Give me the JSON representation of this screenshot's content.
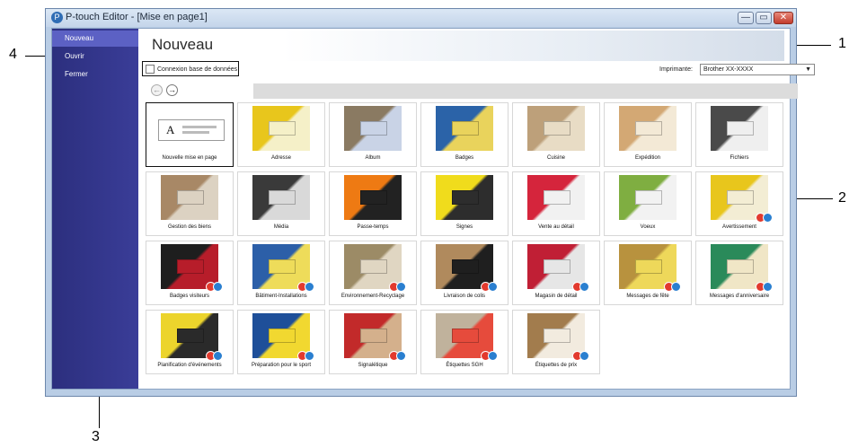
{
  "window": {
    "title": "P-touch Editor - [Mise en page1]",
    "controls": {
      "minimize": "—",
      "maximize": "▭",
      "close": "✕"
    }
  },
  "sidebar": {
    "items": [
      {
        "label": "Nouveau",
        "active": true
      },
      {
        "label": "Ouvrir",
        "active": false
      },
      {
        "label": "Fermer",
        "active": false
      }
    ]
  },
  "main": {
    "title": "Nouveau",
    "database_checkbox_label": "Connexion base de données",
    "database_checked": false,
    "printer_label": "Imprimante:",
    "printer_value": "Brother XX-XXXX",
    "nav_back": "←",
    "nav_forward": "→"
  },
  "new_layout_tile": {
    "label": "Nouvelle mise en page",
    "letter": "A"
  },
  "templates": [
    {
      "label": "Adresse",
      "colors": [
        "#e8c61c",
        "#f5f0c8"
      ]
    },
    {
      "label": "Album",
      "colors": [
        "#8a7a62",
        "#c9d3e6"
      ]
    },
    {
      "label": "Badges",
      "colors": [
        "#2b63a8",
        "#e9d35c"
      ]
    },
    {
      "label": "Cuisine",
      "colors": [
        "#bda07a",
        "#e8dcc5"
      ]
    },
    {
      "label": "Expédition",
      "colors": [
        "#d3a874",
        "#f3e9d6"
      ]
    },
    {
      "label": "Fichiers",
      "colors": [
        "#4a4a4a",
        "#efefef"
      ]
    },
    {
      "label": "Gestion des biens",
      "colors": [
        "#a88866",
        "#dcd2c2"
      ]
    },
    {
      "label": "Média",
      "colors": [
        "#3a3a3a",
        "#d9d9d9"
      ]
    },
    {
      "label": "Passe-temps",
      "colors": [
        "#ee7a13",
        "#222222"
      ]
    },
    {
      "label": "Signes",
      "colors": [
        "#f0dc1c",
        "#2d2d2d"
      ]
    },
    {
      "label": "Vente au détail",
      "colors": [
        "#d5253c",
        "#f1f1f1"
      ]
    },
    {
      "label": "Voeux",
      "colors": [
        "#7fae41",
        "#f2f2f2"
      ]
    },
    {
      "label": "Avertissement",
      "colors": [
        "#e8c61c",
        "#f3edd4"
      ]
    },
    {
      "label": "Badges visiteurs",
      "colors": [
        "#1e1e1e",
        "#b71d2a"
      ]
    },
    {
      "label": "Bâtiment-Installations",
      "colors": [
        "#2c5fa8",
        "#eedc5a"
      ]
    },
    {
      "label": "Environnement-Recyclage",
      "colors": [
        "#9c8b66",
        "#e0d6c2"
      ]
    },
    {
      "label": "Livraison de colis",
      "colors": [
        "#b08a5d",
        "#1f1f1f"
      ]
    },
    {
      "label": "Magasin de détail",
      "colors": [
        "#c01f35",
        "#e6e6e6"
      ]
    },
    {
      "label": "Messages de fête",
      "colors": [
        "#b8923e",
        "#eed85a"
      ]
    },
    {
      "label": "Messages d'anniversaire",
      "colors": [
        "#2a8a5a",
        "#f0e6c6"
      ]
    },
    {
      "label": "Planification d'événements",
      "colors": [
        "#ecd42c",
        "#2a2a2a"
      ]
    },
    {
      "label": "Préparation pour le sport",
      "colors": [
        "#1e4f99",
        "#f1d830"
      ]
    },
    {
      "label": "Signalétique",
      "colors": [
        "#c22a2a",
        "#d4b08c"
      ]
    },
    {
      "label": "Étiquettes SGH",
      "colors": [
        "#c0b29c",
        "#e64b3c"
      ]
    },
    {
      "label": "Étiquettes de prix",
      "colors": [
        "#a27c4d",
        "#f2ebdf"
      ]
    }
  ],
  "callouts": {
    "c1": "1",
    "c2": "2",
    "c3": "3",
    "c4": "4"
  },
  "colors": {
    "sidebar": "#2c2f7e",
    "sidebar_active": "#5c61c4",
    "window_frame": "#b9cde5"
  }
}
